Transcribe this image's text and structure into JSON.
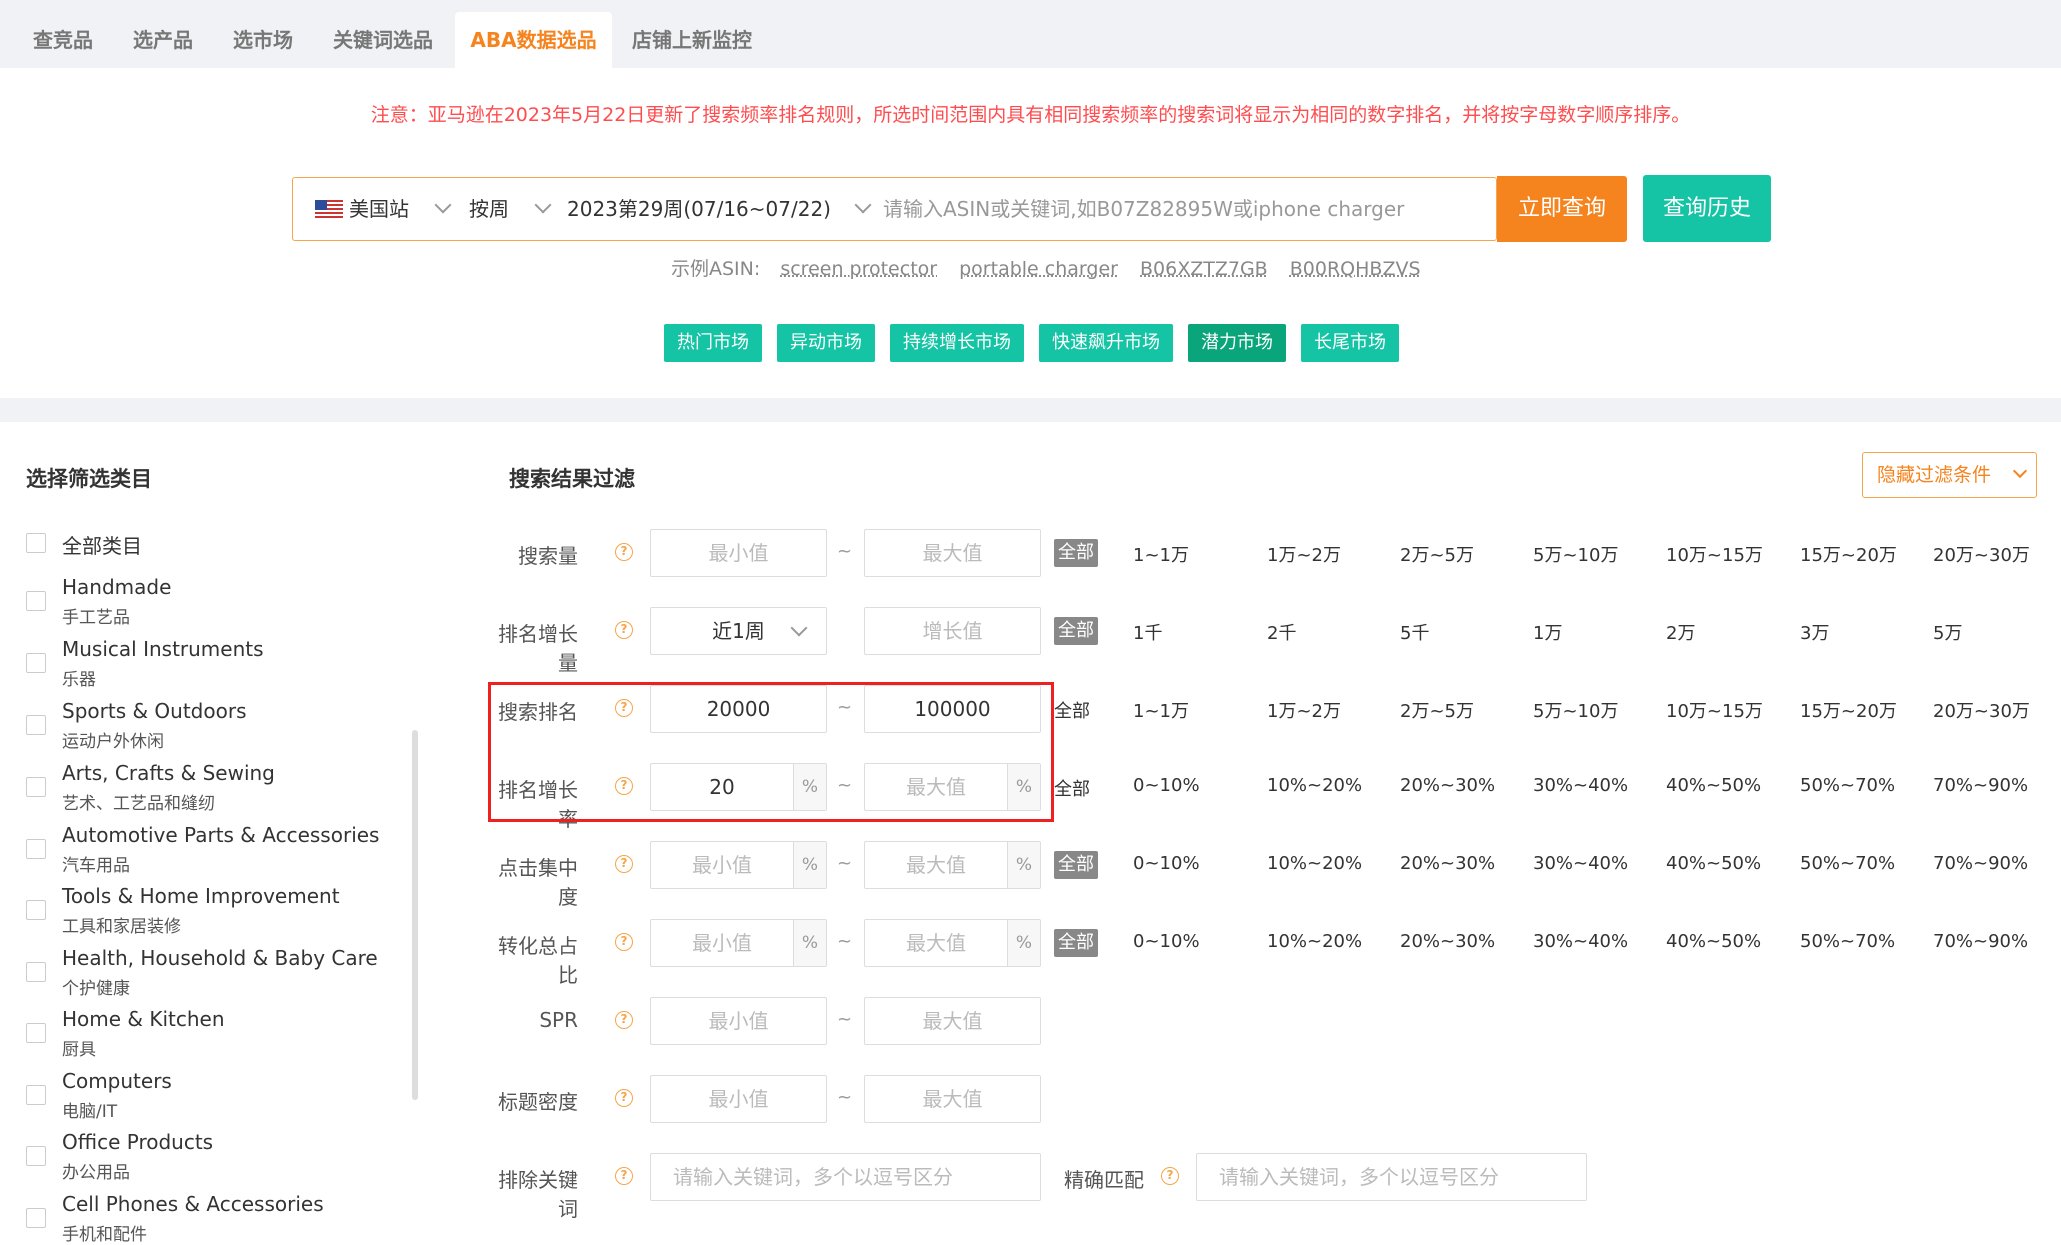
{
  "tabs": [
    "查竞品",
    "选产品",
    "选市场",
    "关键词选品",
    "ABA数据选品",
    "店铺上新监控"
  ],
  "notice": "注意：亚马逊在2023年5月22日更新了搜索频率排名规则，所选时间范围内具有相同搜索频率的搜索词将显示为相同的数字排名，并将按字母数字顺序排序。",
  "search": {
    "site": "美国站",
    "period": "按周",
    "week": "2023第29周(07/16~07/22)",
    "placeholder": "请输入ASIN或关键词,如B07Z82895W或iphone charger",
    "query_button": "立即查询",
    "history_button": "查询历史"
  },
  "examples": {
    "label": "示例ASIN:",
    "items": [
      "screen protector",
      "portable charger",
      "B06XZTZ7GB",
      "B00RQHBZVS"
    ]
  },
  "markets": [
    "热门市场",
    "异动市场",
    "持续增长市场",
    "快速飙升市场",
    "潜力市场",
    "长尾市场"
  ],
  "category_title": "选择筛选类目",
  "categories": [
    {
      "en": "全部类目",
      "cn": ""
    },
    {
      "en": "Handmade",
      "cn": "手工艺品"
    },
    {
      "en": "Musical Instruments",
      "cn": "乐器"
    },
    {
      "en": "Sports & Outdoors",
      "cn": "运动户外休闲"
    },
    {
      "en": "Arts, Crafts & Sewing",
      "cn": "艺术、工艺品和缝纫"
    },
    {
      "en": "Automotive Parts & Accessories",
      "cn": "汽车用品"
    },
    {
      "en": "Tools & Home Improvement",
      "cn": "工具和家居装修"
    },
    {
      "en": "Health, Household & Baby Care",
      "cn": "个护健康"
    },
    {
      "en": "Home & Kitchen",
      "cn": "厨具"
    },
    {
      "en": "Computers",
      "cn": "电脑/IT"
    },
    {
      "en": "Office Products",
      "cn": "办公用品"
    },
    {
      "en": "Cell Phones & Accessories",
      "cn": "手机和配件"
    }
  ],
  "filter_title": "搜索结果过滤",
  "hide_filter": "隐藏过滤条件",
  "common": {
    "min": "最小值",
    "max": "最大值",
    "all": "全部",
    "pct": "%",
    "tilde": "~",
    "help": "?"
  },
  "rows": {
    "search_volume": {
      "label": "搜索量",
      "opts": [
        "1~1万",
        "1万~2万",
        "2万~5万",
        "5万~10万",
        "10万~15万",
        "15万~20万",
        "20万~30万"
      ]
    },
    "rank_growth": {
      "label": "排名增长量",
      "select": "近1周",
      "placeholder": "增长值",
      "opts": [
        "1千",
        "2千",
        "5千",
        "1万",
        "2万",
        "3万",
        "5万"
      ]
    },
    "search_rank": {
      "label": "搜索排名",
      "min_value": "20000",
      "max_value": "100000",
      "opts": [
        "1~1万",
        "1万~2万",
        "2万~5万",
        "5万~10万",
        "10万~15万",
        "15万~20万",
        "20万~30万"
      ]
    },
    "rank_growth_rate": {
      "label": "排名增长率",
      "min_value": "20",
      "opts": [
        "0~10%",
        "10%~20%",
        "20%~30%",
        "30%~40%",
        "40%~50%",
        "50%~70%",
        "70%~90%"
      ]
    },
    "click_concentration": {
      "label": "点击集中度",
      "opts": [
        "0~10%",
        "10%~20%",
        "20%~30%",
        "30%~40%",
        "40%~50%",
        "50%~70%",
        "70%~90%"
      ]
    },
    "conversion_share": {
      "label": "转化总占比",
      "opts": [
        "0~10%",
        "10%~20%",
        "20%~30%",
        "30%~40%",
        "40%~50%",
        "50%~70%",
        "70%~90%"
      ]
    },
    "spr": {
      "label": "SPR"
    },
    "title_density": {
      "label": "标题密度"
    },
    "exclude_keywords": {
      "label": "排除关键词",
      "placeholder": "请输入关键词，多个以逗号区分"
    },
    "exact_match": {
      "label": "精确匹配",
      "placeholder": "请输入关键词，多个以逗号区分"
    }
  },
  "colors": {
    "accent": "#f5841f",
    "teal": "#14c4a4",
    "highlight_box": "#f02020"
  }
}
